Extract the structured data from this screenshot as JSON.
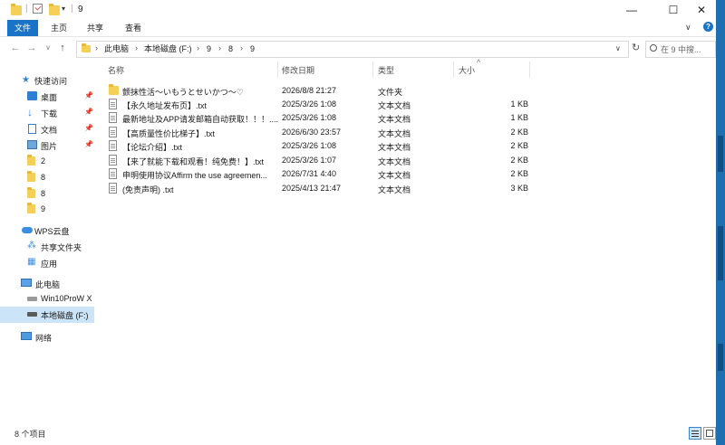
{
  "window": {
    "title": "9",
    "quick_access_separator": "|",
    "quick_access_arrow": "▾",
    "minimize": "—",
    "maximize": "☐",
    "close": "✕",
    "help": "?",
    "expand_ribbon": "∨"
  },
  "ribbon": {
    "tabs": [
      {
        "label": "文件"
      },
      {
        "label": "主页"
      },
      {
        "label": "共享"
      },
      {
        "label": "查看"
      }
    ]
  },
  "nav": {
    "back": "←",
    "forward": "→",
    "recent": "∨",
    "up": "↑",
    "breadcrumb": [
      "此电脑",
      "本地磁盘 (F:)",
      "9",
      "8",
      "9"
    ],
    "separator": "›",
    "dropdown": "∨",
    "refresh": "↻",
    "search_placeholder": "在 9 中搜..."
  },
  "sidebar": {
    "quick_access": "快速访问",
    "items": [
      {
        "label": "桌面",
        "icon": "desktop-icon",
        "pinned": true
      },
      {
        "label": "下载",
        "icon": "download-icon",
        "pinned": true
      },
      {
        "label": "文档",
        "icon": "document-icon",
        "pinned": true
      },
      {
        "label": "图片",
        "icon": "picture-icon",
        "pinned": true
      },
      {
        "label": "2",
        "icon": "folder-icon"
      },
      {
        "label": "8",
        "icon": "folder-icon"
      },
      {
        "label": "8",
        "icon": "folder-icon"
      },
      {
        "label": "9",
        "icon": "folder-icon"
      }
    ],
    "wps": "WPS云盘",
    "wps_items": [
      {
        "label": "共享文件夹"
      },
      {
        "label": "应用"
      }
    ],
    "this_pc": "此电脑",
    "drives": [
      {
        "label": "Win10ProW X"
      },
      {
        "label": "本地磁盘 (F:)"
      }
    ],
    "network": "网络",
    "pin_glyph": "📌"
  },
  "columns": {
    "name": "名称",
    "modified": "修改日期",
    "type": "类型",
    "size": "大小",
    "sort_glyph": "^"
  },
  "files": [
    {
      "name": "颤抹性活～いもうとせいかつ～♡",
      "date": "2026/8/8 21:27",
      "type": "文件夹",
      "size": "",
      "kind": "folder"
    },
    {
      "name": "【永久地址发布页】.txt",
      "date": "2025/3/26 1:08",
      "type": "文本文档",
      "size": "1 KB",
      "kind": "txt"
    },
    {
      "name": "最新地址及APP请发邮箱自动获取！！！....",
      "date": "2025/3/26 1:08",
      "type": "文本文档",
      "size": "1 KB",
      "kind": "txt"
    },
    {
      "name": "【高质量性价比梯子】.txt",
      "date": "2026/6/30 23:57",
      "type": "文本文档",
      "size": "2 KB",
      "kind": "txt"
    },
    {
      "name": "【论坛介绍】.txt",
      "date": "2025/3/26 1:08",
      "type": "文本文档",
      "size": "2 KB",
      "kind": "txt"
    },
    {
      "name": "【来了就能下载和观看！纯免费！】.txt",
      "date": "2025/3/26 1:07",
      "type": "文本文档",
      "size": "2 KB",
      "kind": "txt"
    },
    {
      "name": "申明使用协议Affirm the use agreemen...",
      "date": "2026/7/31 4:40",
      "type": "文本文档",
      "size": "2 KB",
      "kind": "txt"
    },
    {
      "name": "(免责声明) .txt",
      "date": "2025/4/13 21:47",
      "type": "文本文档",
      "size": "3 KB",
      "kind": "txt"
    }
  ],
  "status": {
    "count": "8 个项目"
  },
  "colors": {
    "accent": "#1a73c7",
    "folder": "#f6cf57",
    "selection": "#cce4f7"
  }
}
